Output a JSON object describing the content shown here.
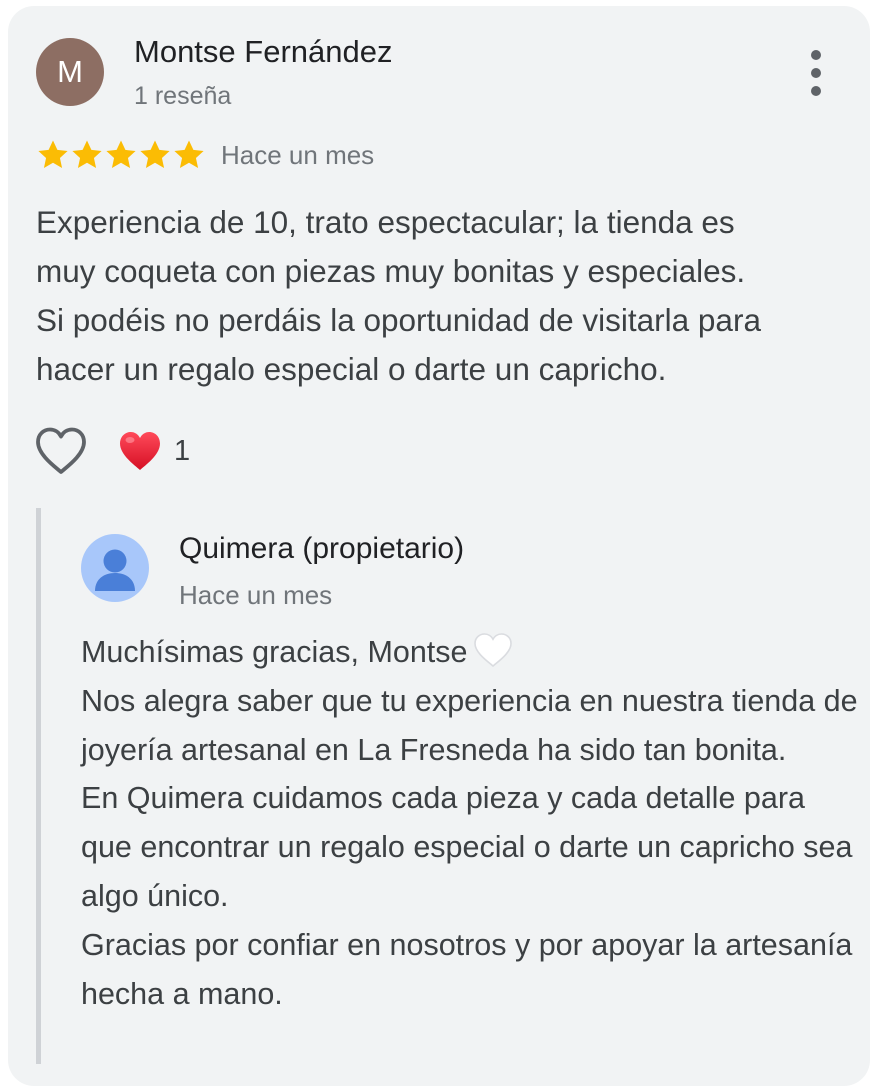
{
  "review": {
    "author_initial": "M",
    "author_name": "Montse Fernández",
    "author_meta": "1 reseña",
    "rating": 5,
    "rating_max": 5,
    "date": "Hace un mes",
    "text": "Experiencia de 10, trato espectacular; la tienda es\nmuy coqueta con piezas muy bonitas y especiales.\nSi podéis no perdáis la oportunidad de visitarla para\nhacer un regalo especial o darte un capricho.",
    "reaction_count": "1",
    "icons": {
      "more": "more-vert-icon",
      "star": "star-icon",
      "like": "heart-outline-icon",
      "reaction": "red-heart-icon"
    }
  },
  "owner_reply": {
    "name": "Quimera (propietario)",
    "date": "Hace un mes",
    "lines": [
      "Muchísimas gracias, Montse",
      "Nos alegra saber que tu experiencia en nuestra tienda de joyería artesanal en La Fresneda ha sido tan bonita.",
      "En Quimera cuidamos cada pieza y cada detalle para que encontrar un regalo especial o darte un capricho sea algo único.",
      "Gracias por confiar en nosotros y por apoyar la artesanía hecha a mano."
    ],
    "icons": {
      "avatar": "person-avatar-icon",
      "inline": "white-heart-icon"
    }
  },
  "colors": {
    "card_background": "#f1f3f4",
    "star": "#fbbc04",
    "author_avatar": "#8d6e63",
    "owner_avatar": "#a8c7fa",
    "owner_avatar_figure": "#4a7fd8",
    "reaction_heart": "#e0182d"
  }
}
